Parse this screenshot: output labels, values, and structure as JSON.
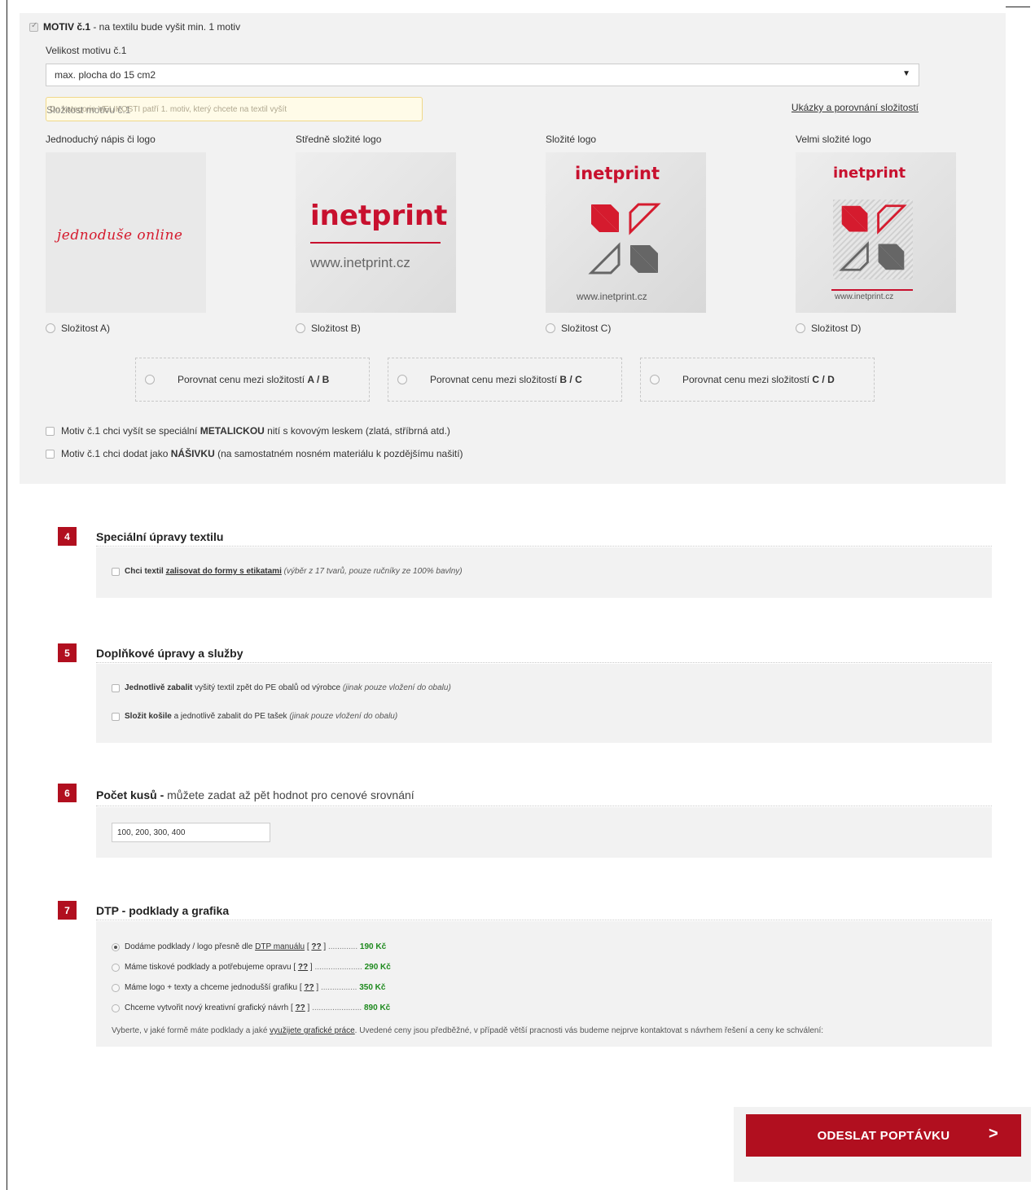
{
  "motive": {
    "head_bold": "MOTIV č.1",
    "head_rest": " - na textilu bude vyšit min. 1 motiv",
    "size_label": "Velikost motivu č.1",
    "size_value": "max. plocha do 15 cm2",
    "tooltip_label": "Složitost motivu č.1",
    "tooltip_text": "Do kategorie VELIKOSTI patří 1. motiv, který chcete na textil vyšít",
    "examples_link": "Ukázky a porovnání složitostí",
    "complexities": [
      {
        "title": "Jednoduchý nápis či logo",
        "option": "Složitost A)",
        "image_text": "jednoduše online"
      },
      {
        "title": "Středně složité logo",
        "option": "Složitost B)",
        "image_text": "inetprint",
        "image_sub": "www.inetprint.cz"
      },
      {
        "title": "Složité logo",
        "option": "Složitost C)",
        "image_text": "inetprint",
        "image_sub": "www.inetprint.cz"
      },
      {
        "title": "Velmi složité logo",
        "option": "Složitost D)",
        "image_text": "inetprint",
        "image_sub": "www.inetprint.cz"
      }
    ],
    "compare": [
      {
        "text": "Porovnat cenu mezi složitostí ",
        "bold": "A / B"
      },
      {
        "text": "Porovnat cenu mezi složitostí ",
        "bold": "B / C"
      },
      {
        "text": "Porovnat cenu mezi složitostí ",
        "bold": "C / D"
      }
    ],
    "metallic": {
      "pre": "Motiv č.1 chci vyšít se speciální ",
      "bold": "METALICKOU",
      "post": " nití s kovovým leskem (zlatá, stříbrná atd.)"
    },
    "patch": {
      "pre": "Motiv č.1 chci dodat jako ",
      "bold": "NÁŠIVKU",
      "post": " (na samostatném nosném materiálu k pozdějšímu našití)"
    }
  },
  "section4": {
    "num": "4",
    "title": "Speciální úpravy textilu",
    "opt_bold": "Chci textil ",
    "opt_link": "zalisovat do formy s etikatami",
    "opt_italic": " (výběr z 17 tvarů, pouze ručníky ze 100% bavlny)"
  },
  "section5": {
    "num": "5",
    "title": "Doplňkové úpravy a služby",
    "opt1_bold": "Jednotlivě zabalit",
    "opt1_rest": " vyšitý textil zpět do PE obalů od výrobce ",
    "opt1_italic": "(jinak pouze vložení do obalu)",
    "opt2_bold": "Složit košile",
    "opt2_rest": " a jednotlivě zabalit do PE tašek ",
    "opt2_italic": "(jinak pouze vložení do obalu)"
  },
  "section6": {
    "num": "6",
    "title_bold": "Počet kusů -",
    "title_rest": " můžete zadat až pět hodnot pro cenové srovnání",
    "input_value": "100, 200, 300, 400"
  },
  "section7": {
    "num": "7",
    "title": "DTP - podklady a grafika",
    "options": [
      {
        "pre": "Dodáme podklady / logo přesně dle ",
        "link": "DTP manuálu",
        "help": "??",
        "dots": " ............. ",
        "price": "190 Kč"
      },
      {
        "pre": "Máme tiskové podklady a potřebujeme opravu",
        "link": "",
        "help": "??",
        "dots": " ..................... ",
        "price": "290 Kč"
      },
      {
        "pre": "Máme logo + texty a chceme jednodušší grafiku",
        "link": "",
        "help": "??",
        "dots": " ................ ",
        "price": "350 Kč"
      },
      {
        "pre": "Chceme vytvořit nový kreativní grafický návrh",
        "link": "",
        "help": "??",
        "dots": " ...................... ",
        "price": "890 Kč"
      }
    ],
    "note_pre": "Vyberte, v jaké formě máte podklady a jaké ",
    "note_link": "využijete grafické práce",
    "note_post": ". Uvedené ceny jsou předběžné, v případě větší pracnosti vás budeme nejprve kontaktovat s návrhem řešení a ceny ke schválení:"
  },
  "submit": {
    "label": "ODESLAT POPTÁVKU",
    "icon": "chevron-right-icon"
  },
  "colors": {
    "accent": "#b10f1f",
    "price": "#1e8a1e",
    "panel": "#f2f2f2"
  }
}
